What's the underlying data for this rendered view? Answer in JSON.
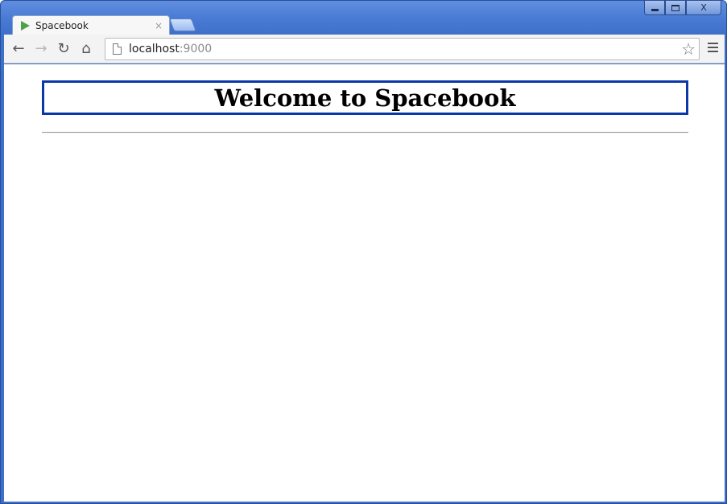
{
  "window": {
    "controls": {
      "minimize_icon": "minimize-icon",
      "maximize_icon": "maximize-icon",
      "close_label": "X"
    }
  },
  "tabs": [
    {
      "title": "Spacebook",
      "icon": "play-favicon-icon",
      "close_label": "×"
    }
  ],
  "toolbar": {
    "back_label": "←",
    "forward_label": "→",
    "reload_label": "↻",
    "home_label": "⌂",
    "url_host": "localhost",
    "url_port": ":9000",
    "bookmark_label": "☆"
  },
  "page": {
    "heading": "Welcome to Spacebook"
  },
  "colors": {
    "heading_border": "#0a38a8",
    "window_frame": "#4a7bd4",
    "favicon": "#4da14a"
  }
}
